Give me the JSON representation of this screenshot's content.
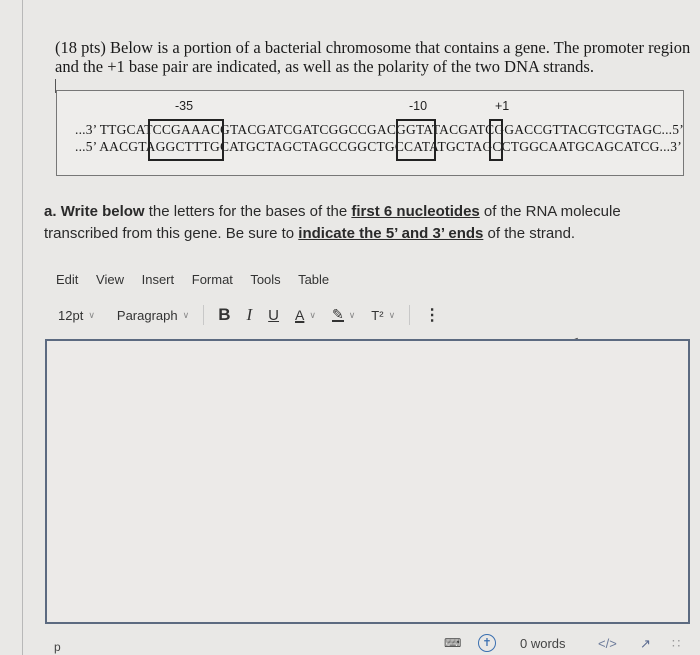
{
  "question": {
    "intro": "(18 pts) Below is a portion of a bacterial chromosome that contains a gene. The promoter region and the +1 base pair are indicated, as well as the polarity of the two DNA strands."
  },
  "sequence": {
    "labels": {
      "minus35": "-35",
      "minus10": "-10",
      "plus1": "+1"
    },
    "top_strand": "...3’ TTGCATCCGAAACGTACGATCGATCGGCCGACGGTATACGATCGGACCGTTACGTCGTAGC...5’",
    "bottom_strand": "...5’ AACGTAGGCTTTGCATGCTAGCTAGCCGGCTGCCATATGCTAGCCTGGCAATGCAGCATCG...3’",
    "boxed_regions": [
      {
        "name": "-35",
        "top": "TCCGAAAC",
        "bottom": "AGGCTTTG"
      },
      {
        "name": "-10",
        "top": "TATA",
        "bottom": "ATAT"
      },
      {
        "name": "+1",
        "top": "A",
        "bottom": "T"
      }
    ]
  },
  "part_a": {
    "prefix": "a. ",
    "bold1": "Write below",
    "text1": " the letters for the bases of the ",
    "underline1": "first 6 nucleotides",
    "text2": " of the RNA molecule transcribed from this gene. Be sure to ",
    "underline2": "indicate the 5’ and 3’ ends",
    "text3": " of the strand."
  },
  "editor": {
    "menu": [
      "Edit",
      "View",
      "Insert",
      "Format",
      "Tools",
      "Table"
    ],
    "font_size": "12pt",
    "block_format": "Paragraph",
    "bold_label": "B",
    "italic_label": "I",
    "underline_label": "U",
    "text_color_label": "A",
    "superscript_label": "T²",
    "more_label": "⋮",
    "content": "",
    "status_path": "p",
    "word_count": "0 words",
    "code_label": "</>"
  }
}
